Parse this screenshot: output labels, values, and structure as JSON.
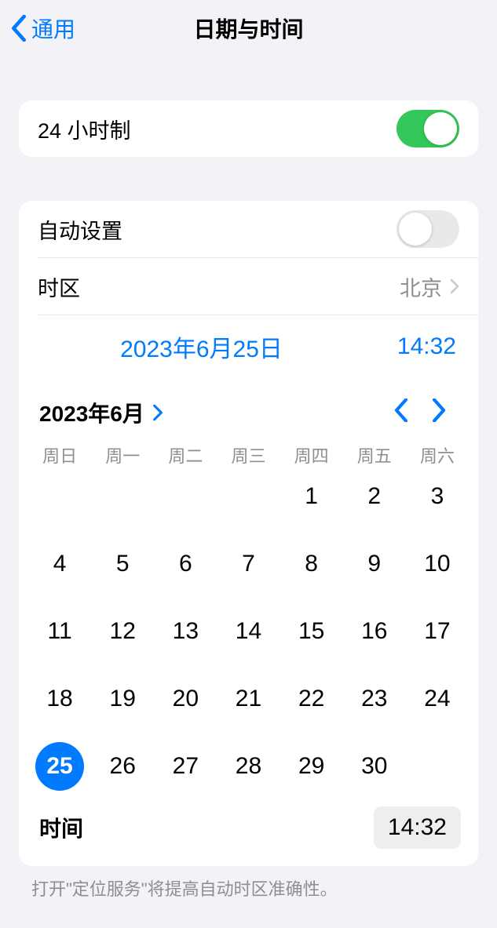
{
  "header": {
    "back": "通用",
    "title": "日期与时间"
  },
  "rows": {
    "twentyFourHour": "24 小时制",
    "autoSet": "自动设置",
    "timezone": "时区",
    "timezoneValue": "北京"
  },
  "summary": {
    "date": "2023年6月25日",
    "time": "14:32"
  },
  "calendar": {
    "monthLabel": "2023年6月",
    "weekdays": [
      "周日",
      "周一",
      "周二",
      "周三",
      "周四",
      "周五",
      "周六"
    ],
    "startOffset": 4,
    "daysInMonth": 30,
    "selectedDay": 25
  },
  "timeRow": {
    "label": "时间",
    "value": "14:32"
  },
  "footer": "打开\"定位服务\"将提高自动时区准确性。"
}
